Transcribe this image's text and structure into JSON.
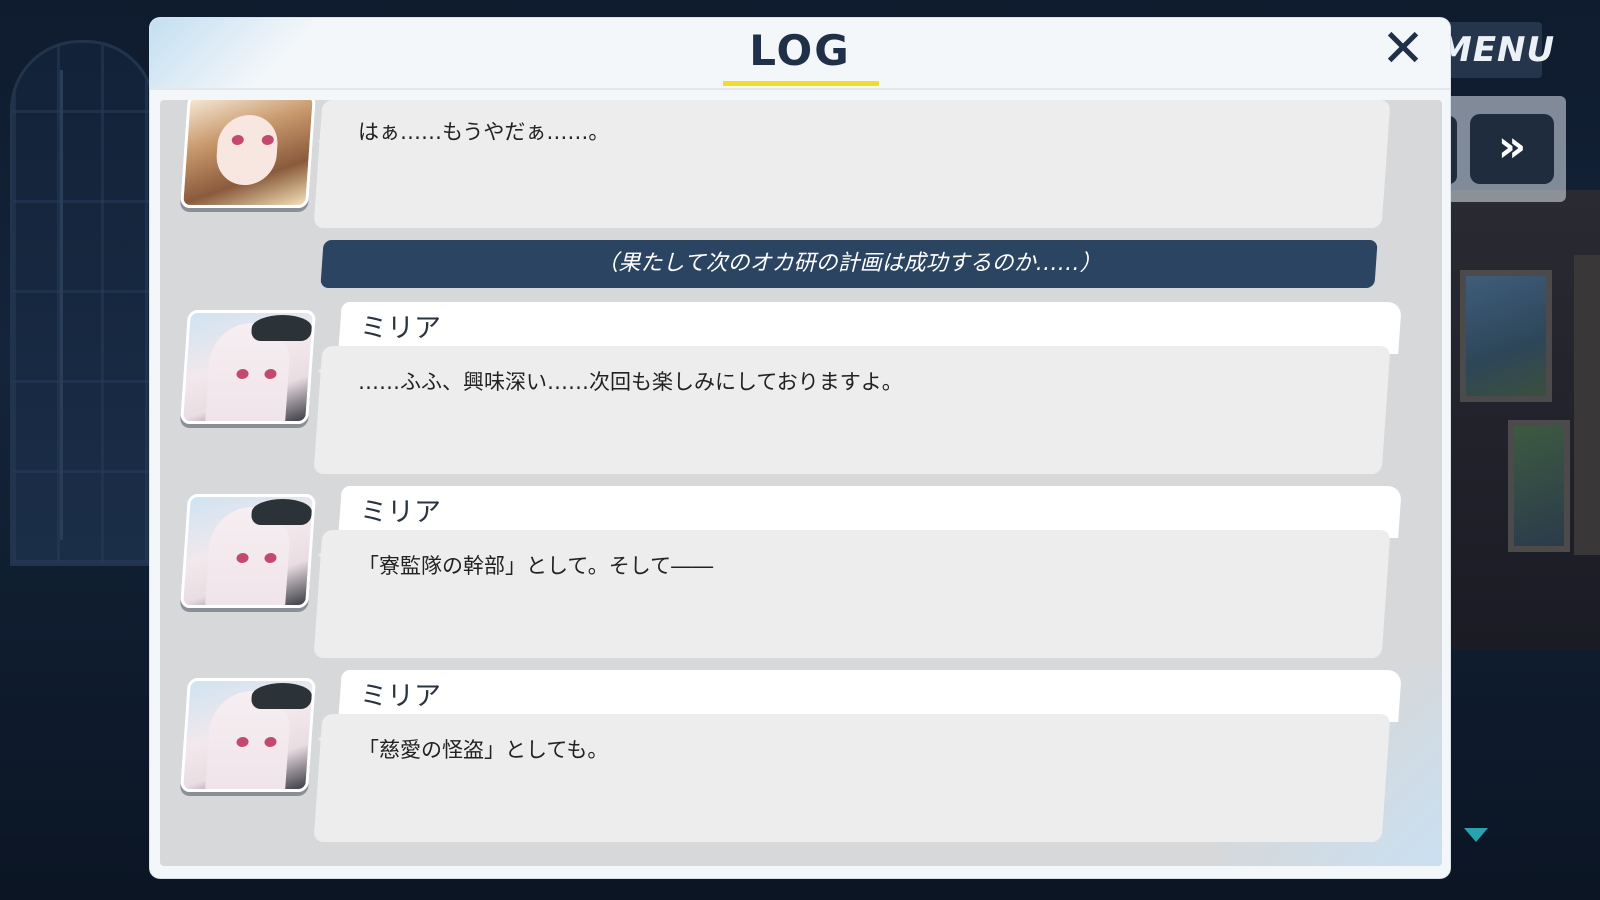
{
  "header": {
    "title": "LOG",
    "close_label": "✕"
  },
  "menu": {
    "label": "MENU"
  },
  "controls": {
    "fast_forward_label": "»"
  },
  "log": {
    "entries": [
      {
        "speaker": "",
        "avatar": "character-portrait",
        "text": "はぁ……もうやだぁ……。"
      },
      {
        "narration": "（果たして次のオカ研の計画は成功するのか……）"
      },
      {
        "speaker": "ミリア",
        "avatar": "milia-portrait",
        "text": "……ふふ、興味深い……次回も楽しみにしておりますよ。"
      },
      {
        "speaker": "ミリア",
        "avatar": "milia-portrait",
        "text": "「寮監隊の幹部」として。そして――"
      },
      {
        "speaker": "ミリア",
        "avatar": "milia-portrait",
        "text": "「慈愛の怪盗」としても。"
      }
    ]
  },
  "colors": {
    "accent": "#f2de2a",
    "narration_bg": "#2b4462",
    "title": "#1f3048",
    "scroll_arrow": "#2aa3b0"
  },
  "icons": {
    "close": "close-icon",
    "scroll": "chevron-down-icon",
    "fast_forward": "fast-forward-icon"
  }
}
